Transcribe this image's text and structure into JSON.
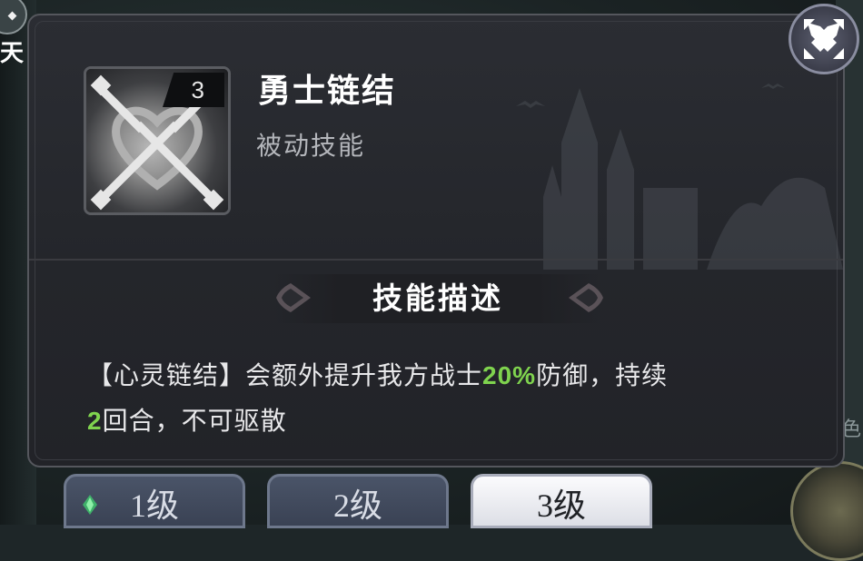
{
  "left_edge": {
    "char": "天"
  },
  "right_edge": {
    "char": "色"
  },
  "skill": {
    "level": "3",
    "name": "勇士链结",
    "type": "被动技能"
  },
  "section": {
    "title": "技能描述"
  },
  "description": {
    "part1": "【心灵链结】会额外提升我方战士",
    "highlight1": "20%",
    "part2": "防御，持续",
    "highlight2": "2",
    "part3": "回合，不可驱散",
    "highlight_color": "#7fd34e"
  },
  "tabs": [
    {
      "label": "1级",
      "active": false
    },
    {
      "label": "2级",
      "active": false
    },
    {
      "label": "3级",
      "active": true
    }
  ],
  "icons": {
    "close": "close-icon",
    "skill": "chain-heart-icon",
    "gem": "gem-icon"
  }
}
